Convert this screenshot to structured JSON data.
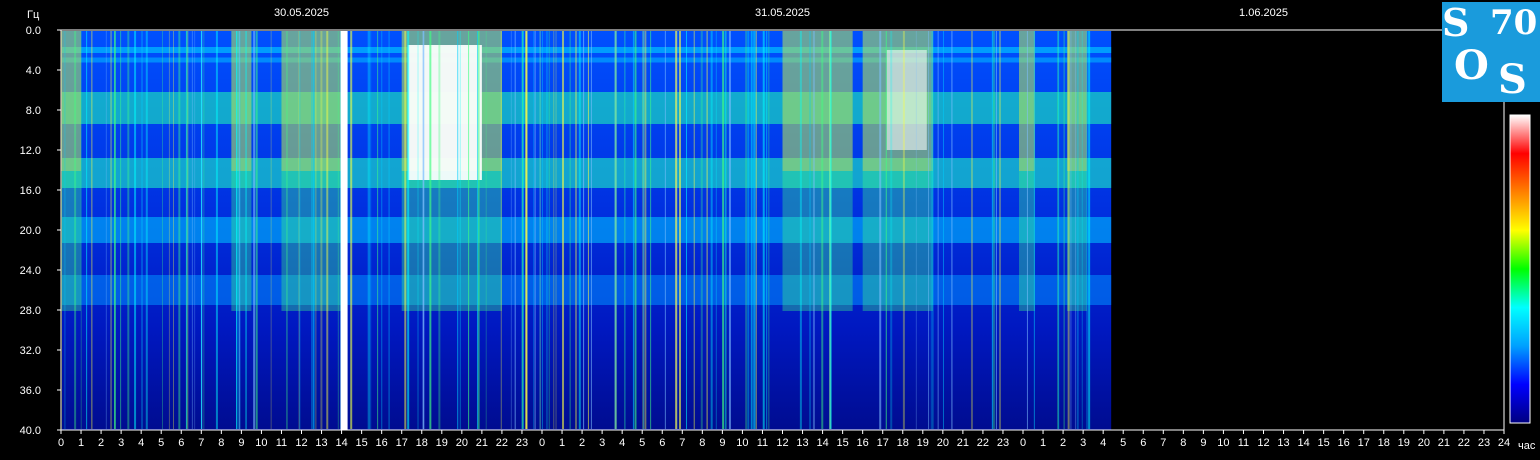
{
  "chart_data": {
    "type": "heatmap",
    "title": "",
    "ylabel": "Гц",
    "xlabel": "час",
    "ylim": [
      40.0,
      0.0
    ],
    "y_ticks": [
      "0.0",
      "4.0",
      "8.0",
      "12.0",
      "16.0",
      "20.0",
      "24.0",
      "28.0",
      "32.0",
      "36.0",
      "40.0"
    ],
    "dates": [
      "30.05.2025",
      "31.05.2025",
      "1.06.2025"
    ],
    "x_ticks": [
      "0",
      "1",
      "2",
      "3",
      "4",
      "5",
      "6",
      "7",
      "8",
      "9",
      "10",
      "11",
      "12",
      "13",
      "14",
      "15",
      "16",
      "17",
      "18",
      "19",
      "20",
      "21",
      "22",
      "23",
      "0",
      "1",
      "2",
      "3",
      "4",
      "5",
      "6",
      "7",
      "8",
      "9",
      "10",
      "11",
      "12",
      "13",
      "14",
      "15",
      "16",
      "17",
      "18",
      "19",
      "20",
      "21",
      "22",
      "23",
      "0",
      "1",
      "2",
      "3",
      "4",
      "5",
      "6",
      "7",
      "8",
      "9",
      "10",
      "11",
      "12",
      "13",
      "14",
      "15",
      "16",
      "17",
      "18",
      "19",
      "20",
      "21",
      "22",
      "23",
      "24"
    ],
    "data_end_hour": 52.4,
    "bands_hz": [
      7.8,
      14.3,
      20.0,
      26.0,
      2.0,
      3.0
    ],
    "bursts_hours": [
      [
        0.0,
        1.0
      ],
      [
        8.5,
        9.5
      ],
      [
        11.0,
        14.0
      ],
      [
        17.0,
        22.0
      ],
      [
        36.0,
        39.5
      ],
      [
        40.0,
        43.5
      ],
      [
        47.8,
        48.6
      ],
      [
        50.2,
        51.2
      ]
    ],
    "saturated_column_hour": 14.1,
    "colorbar": [
      "#000080",
      "#0000ff",
      "#00a0ff",
      "#00ffff",
      "#00ff00",
      "#ffff00",
      "#ff8000",
      "#ff0000",
      "#ffffff"
    ]
  },
  "logo": {
    "letters": [
      "S",
      "70",
      "O",
      "S"
    ],
    "bg": "#1a9bdc"
  }
}
